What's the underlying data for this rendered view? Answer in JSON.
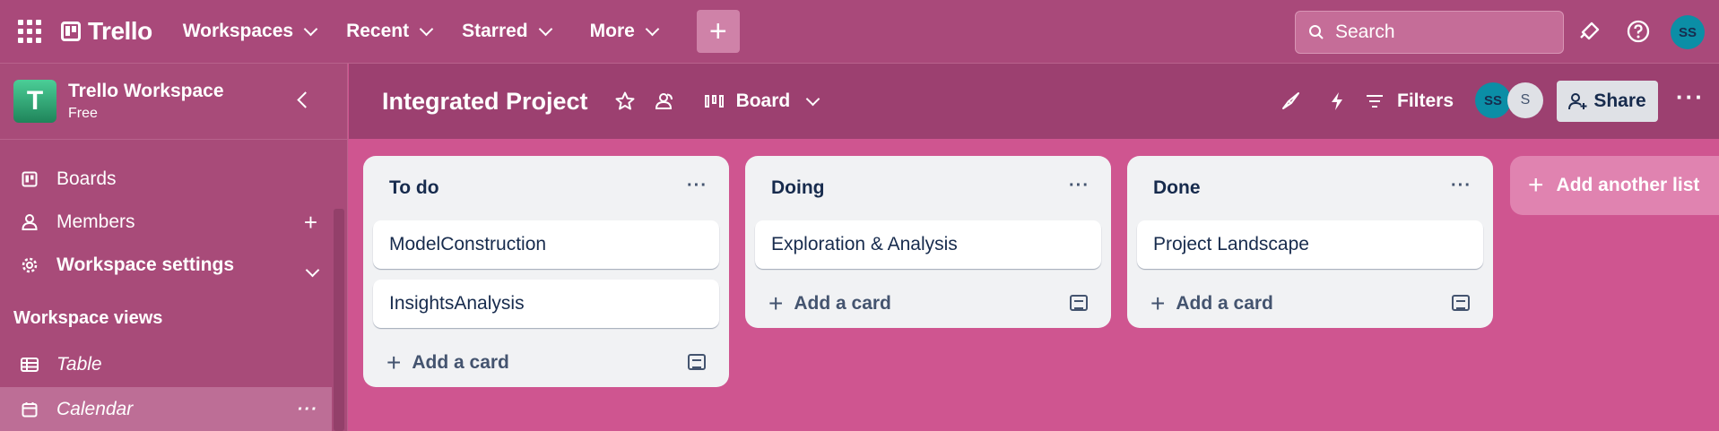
{
  "topbar": {
    "app_name": "Trello",
    "nav": [
      "Workspaces",
      "Recent",
      "Starred",
      "More"
    ],
    "create_symbol": "+",
    "search_placeholder": "Search",
    "user_initials": "SS"
  },
  "sidebar": {
    "workspace_initial": "T",
    "workspace_name": "Trello Workspace",
    "workspace_plan": "Free",
    "items": [
      {
        "label": "Boards"
      },
      {
        "label": "Members"
      },
      {
        "label": "Workspace settings"
      }
    ],
    "views_heading": "Workspace views",
    "views": [
      {
        "label": "Table"
      },
      {
        "label": "Calendar"
      }
    ]
  },
  "board": {
    "title": "Integrated Project",
    "view": "Board",
    "filters_label": "Filters",
    "members": [
      "SS",
      "S"
    ],
    "share_label": "Share"
  },
  "lists": [
    {
      "title": "To do",
      "cards": [
        "ModelConstruction",
        "InsightsAnalysis"
      ],
      "add_label": "Add a card"
    },
    {
      "title": "Doing",
      "cards": [
        "Exploration & Analysis"
      ],
      "add_label": "Add a card"
    },
    {
      "title": "Done",
      "cards": [
        "Project Landscape"
      ],
      "add_label": "Add a card"
    }
  ],
  "add_list_label": "Add another list",
  "colors": {
    "topbar": "#a9497a",
    "board_bg": "#cf5590",
    "board_header": "#9c4070",
    "list_bg": "#f1f2f4",
    "workspace_logo": "#1f845a",
    "avatar": "#0b8ea6"
  },
  "icons": [
    "apps-grid-icon",
    "trello-logo-icon",
    "plus-icon",
    "search-icon",
    "megaphone-icon",
    "help-icon",
    "star-icon",
    "team-visibility-icon",
    "board-view-icon",
    "power-ups-icon",
    "automation-icon",
    "filter-icon",
    "share-person-icon",
    "template-icon"
  ]
}
